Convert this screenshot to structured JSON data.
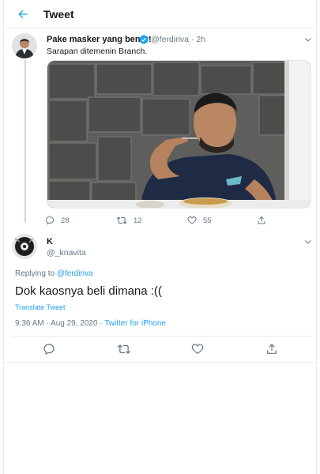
{
  "header": {
    "title": "Tweet"
  },
  "parent_tweet": {
    "name": "Pake masker yang benar!",
    "handle": "@ferdiriva",
    "time": "2h",
    "text": "Sarapan ditemenin Branch.",
    "reply_count": "28",
    "retweet_count": "12",
    "like_count": "55"
  },
  "reply_tweet": {
    "name": "K",
    "handle": "@_knavita",
    "replying_prefix": "Replying to",
    "replying_to": "@ferdiriva",
    "text": "Dok kaosnya beli dimana :((",
    "translate_label": "Translate Tweet",
    "timestamp": "9:36 AM · Aug 29, 2020 · ",
    "source": "Twitter for iPhone"
  },
  "colors": {
    "accent": "#1da1f2",
    "muted": "#657786",
    "text": "#14171a",
    "border": "#e6ecf0"
  },
  "icons": {
    "back": "arrow-left-icon",
    "verified": "verified-badge-icon",
    "caret": "chevron-down-icon",
    "reply": "reply-icon",
    "retweet": "retweet-icon",
    "like": "heart-icon",
    "share": "share-icon"
  }
}
